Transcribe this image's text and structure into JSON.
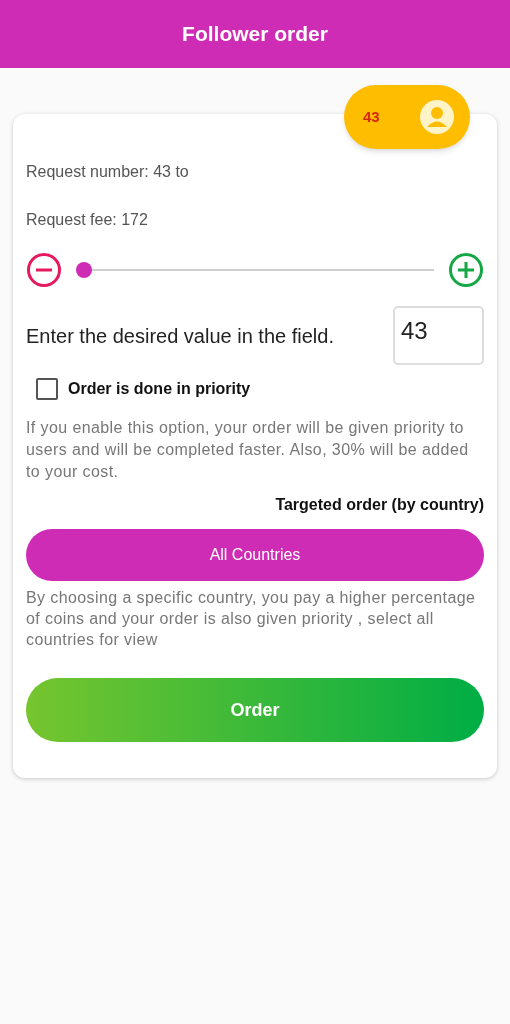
{
  "header": {
    "title": "Follower order"
  },
  "balance": {
    "value": "43"
  },
  "request_number": "Request number: 43 to",
  "request_fee": "Request fee: 172",
  "slider": {
    "level": 0
  },
  "value_field": {
    "label": "Enter the desired value in the field.",
    "value": "43"
  },
  "priority": {
    "label": "Order is done in priority",
    "checked": false,
    "note": "If you enable this option, your order will be given priority to users and will be completed faster. Also, 30% will be added to your cost."
  },
  "targeted": {
    "label": "Targeted order (by country)",
    "button": "All Countries",
    "note": "By choosing a specific country, you pay a higher percentage of coins and your order is also given priority , select all countries for view"
  },
  "order_button": "Order"
}
